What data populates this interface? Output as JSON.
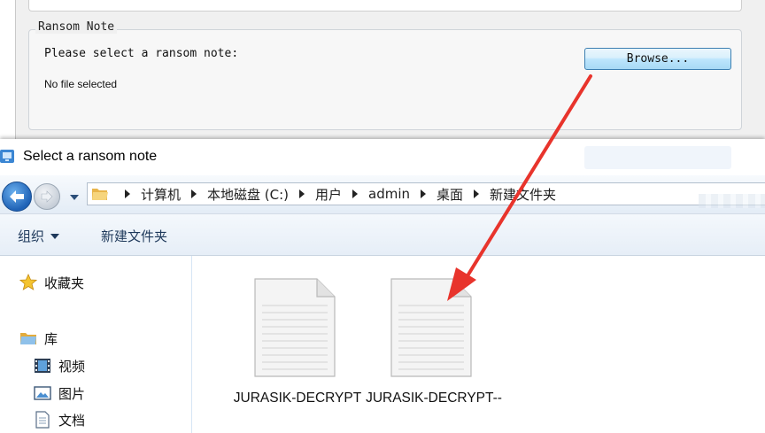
{
  "background_app": {
    "groupbox_label": "Ransom Note",
    "prompt": "Please select a ransom note:",
    "file_status": "No file selected",
    "browse_label": "Browse..."
  },
  "dialog": {
    "title": "Select a ransom note",
    "breadcrumb": [
      "计算机",
      "本地磁盘 (C:)",
      "用户",
      "admin",
      "桌面",
      "新建文件夹"
    ],
    "toolbar": {
      "organize_label": "组织",
      "new_folder_label": "新建文件夹"
    },
    "nav_pane": {
      "favorites": "收藏夹",
      "libraries": "库",
      "videos": "视频",
      "pictures": "图片",
      "documents": "文档"
    },
    "files": [
      {
        "name": "JURASIK-DECRYPT"
      },
      {
        "name": "JURASIK-DECRYPT--"
      }
    ]
  },
  "colors": {
    "annotation_arrow": "#e8342c",
    "button_border": "#3c7fb1",
    "toolbar_text": "#1e395b"
  }
}
